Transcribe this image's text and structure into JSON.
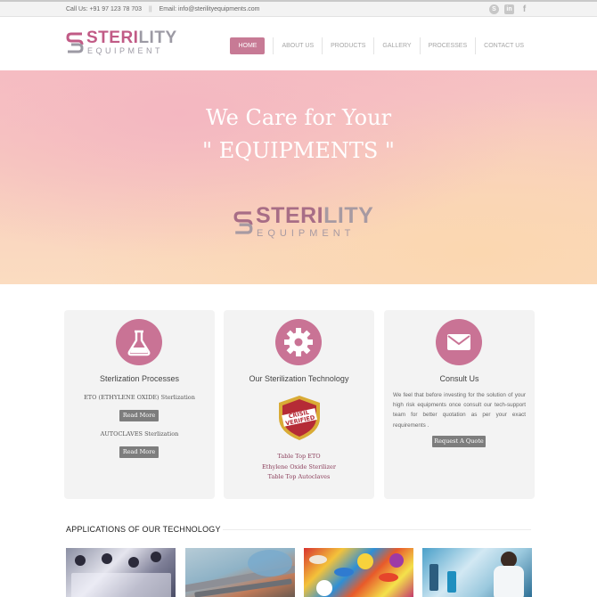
{
  "topbar": {
    "phone": "Call Us: +91 97 123 78 703",
    "divider": "||",
    "email": "Email: info@sterilityequipments.com",
    "social_icons": [
      "skype-icon",
      "linkedin-icon",
      "facebook-icon"
    ]
  },
  "brand": {
    "name_part1": "STERI",
    "name_part2": "LITY",
    "tagline": "EQUIPMENT"
  },
  "nav": {
    "items": [
      {
        "label": "HOME",
        "active": true
      },
      {
        "label": "ABOUT US",
        "active": false
      },
      {
        "label": "PRODUCTS",
        "active": false
      },
      {
        "label": "GALLERY",
        "active": false
      },
      {
        "label": "PROCESSES",
        "active": false
      },
      {
        "label": "CONTACT US",
        "active": false
      }
    ]
  },
  "hero": {
    "line1": "We Care for Your",
    "line2": "\" EQUIPMENTS \""
  },
  "features": {
    "processes": {
      "icon": "flask-icon",
      "title": "Sterlization Processes",
      "item1": "ETO (ETHYLENE OXIDE) Sterlization",
      "button1": "Read More",
      "item2": "AUTOCLAVES Sterlization",
      "button2": "Read More"
    },
    "technology": {
      "icon": "gear-icon",
      "title": "Our Sterilization Technology",
      "badge_text": [
        "CRISIL",
        "VERIFIED"
      ],
      "links": [
        "Table Top ETO",
        "Ethylene Oxide Sterilizer",
        "Table Top Autoclaves"
      ]
    },
    "consult": {
      "icon": "envelope-icon",
      "title": "Consult Us",
      "text": "We feel that before investing for the solution of your high risk equipments once consult our tech-support team for better quotation as per your exact requirements .",
      "button": "Request A Quote"
    }
  },
  "applications": {
    "title": "APPLICATIONS OF OUR TECHNOLOGY",
    "thumbnails": [
      "classroom-photo",
      "surgical-instruments-photo",
      "pills-photo",
      "laboratory-photo"
    ]
  },
  "colors": {
    "accent": "#c97395",
    "nav_active": "#c77a95",
    "button_grey": "#7d7d7d",
    "link": "#8a3d5a"
  }
}
